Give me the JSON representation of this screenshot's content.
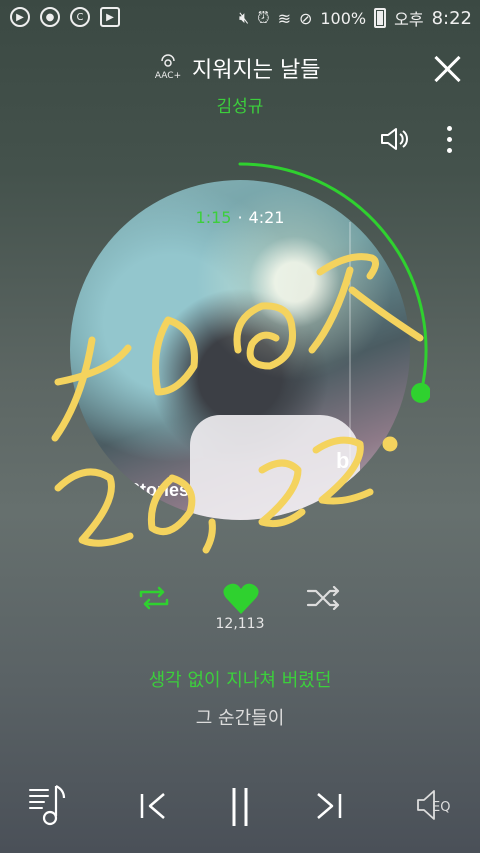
{
  "statusbar": {
    "battery_text": "100%",
    "ampm": "오후",
    "clock": "8:22"
  },
  "header": {
    "quality_badge": "AAC+",
    "song_title": "지워지는 날들",
    "artist": "김성규"
  },
  "album": {
    "cover_text": "Stories",
    "cover_letter": "b"
  },
  "playback": {
    "current_time": "1:15",
    "separator": "·",
    "total_time": "4:21",
    "progress_fraction": 0.287
  },
  "handwriting": {
    "line1": "トロロ ヌ",
    "line2": "20, 22"
  },
  "actions": {
    "like_count": "12,113"
  },
  "lyrics": {
    "current_line": "생각 없이 지나쳐 버렸던",
    "next_line": "그 순간들이"
  },
  "bottom_bar": {
    "eq_label": "EQ"
  },
  "colors": {
    "accent_green": "#3ccf3c",
    "handwriting_yellow": "#f4d35e"
  }
}
